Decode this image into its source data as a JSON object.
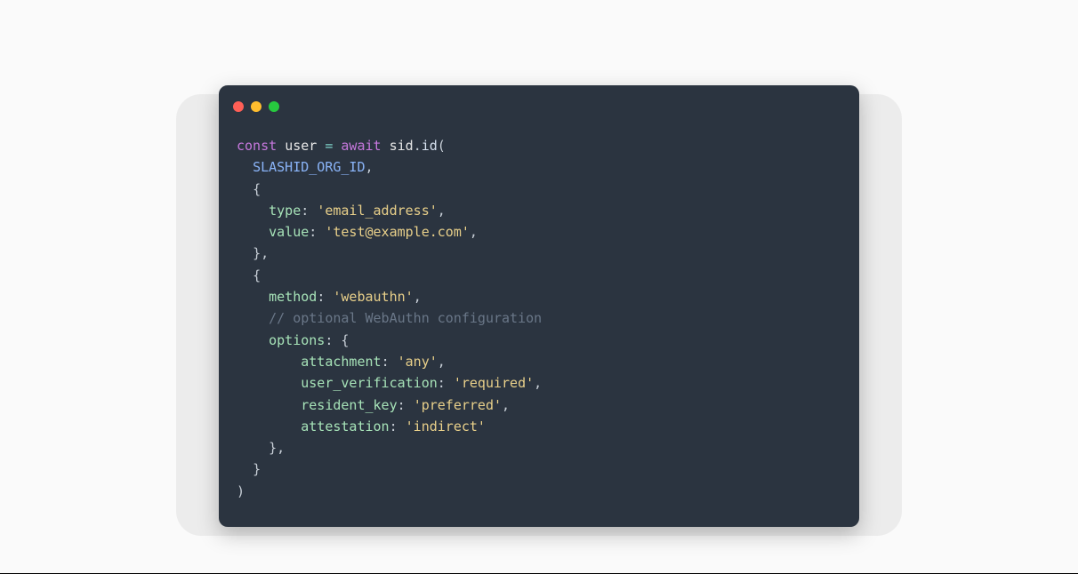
{
  "code": {
    "kw_const": "const",
    "var_user": "user",
    "op_eq": "=",
    "kw_await": "await",
    "obj_sid": "sid",
    "dot1": ".",
    "fn_id": "id",
    "open_paren": "(",
    "arg_org": "SLASHID_ORG_ID",
    "comma": ",",
    "brace_open": "{",
    "brace_close": "}",
    "close_paren": ")",
    "key_type": "type",
    "key_value": "value",
    "key_method": "method",
    "key_options": "options",
    "key_attachment": "attachment",
    "key_user_verification": "user_verification",
    "key_resident_key": "resident_key",
    "key_attestation": "attestation",
    "str_email_addr": "'email_address'",
    "str_test_email": "'test@example.com'",
    "str_webauthn": "'webauthn'",
    "str_any": "'any'",
    "str_required": "'required'",
    "str_preferred": "'preferred'",
    "str_indirect": "'indirect'",
    "comment": "// optional WebAuthn configuration",
    "colon": ":"
  },
  "traffic": {
    "red": "close",
    "yellow": "minimize",
    "green": "zoom"
  }
}
